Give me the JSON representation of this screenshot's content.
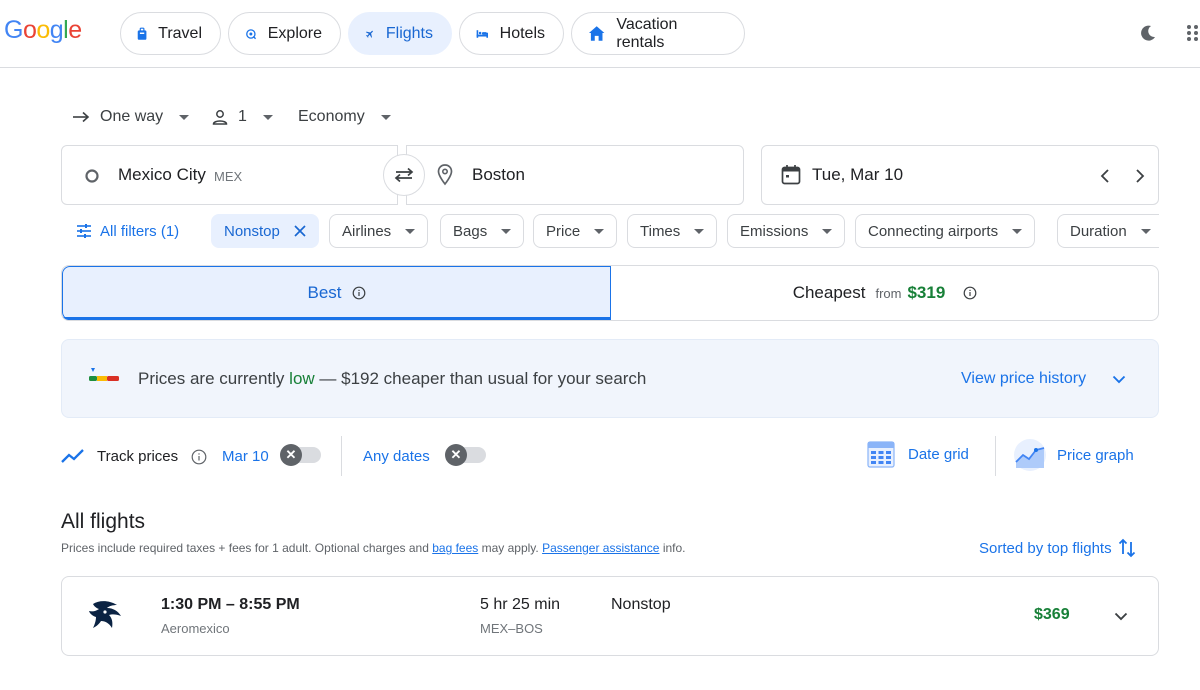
{
  "header": {
    "logo": [
      "G",
      "o",
      "o",
      "g",
      "l",
      "e"
    ],
    "nav": [
      {
        "label": "Travel",
        "icon": "luggage-icon"
      },
      {
        "label": "Explore",
        "icon": "explore-icon"
      },
      {
        "label": "Flights",
        "icon": "airplane-icon",
        "active": true
      },
      {
        "label": "Hotels",
        "icon": "bed-icon"
      },
      {
        "label": "Vacation rentals",
        "icon": "house-icon"
      }
    ]
  },
  "search": {
    "trip_type": "One way",
    "passengers": "1",
    "cabin": "Economy",
    "origin_city": "Mexico City",
    "origin_code": "MEX",
    "destination": "Boston",
    "date": "Tue, Mar 10"
  },
  "filters": {
    "all_filters": "All filters (1)",
    "nonstop": "Nonstop",
    "airlines": "Airlines",
    "bags": "Bags",
    "price": "Price",
    "times": "Times",
    "emissions": "Emissions",
    "connecting": "Connecting airports",
    "duration": "Duration"
  },
  "tabs": {
    "best": "Best",
    "cheapest": "Cheapest",
    "from": "from",
    "cheapest_price": "$319"
  },
  "insight": {
    "prefix": "Prices are currently ",
    "level": "low",
    "suffix": " — $192 cheaper than usual for your search",
    "link": "View price history"
  },
  "tracking": {
    "track_label": "Track prices",
    "track_date": "Mar 10",
    "any_dates": "Any dates",
    "date_grid": "Date grid",
    "price_graph": "Price graph"
  },
  "results": {
    "title": "All flights",
    "note_pre": "Prices include required taxes + fees for 1 adult. Optional charges and ",
    "bag_fees": "bag fees",
    "note_mid": " may apply. ",
    "passenger_assistance": "Passenger assistance",
    "note_post": " info.",
    "sort": "Sorted by top flights"
  },
  "flight": {
    "times": "1:30 PM – 8:55 PM",
    "airline": "Aeromexico",
    "duration": "5 hr 25 min",
    "route": "MEX–BOS",
    "stops": "Nonstop",
    "price": "$369"
  },
  "colors": {
    "blue": "#1a73e8",
    "active_bg": "#e8f0fe",
    "price_green": "#188038",
    "low_green": "#188038"
  }
}
